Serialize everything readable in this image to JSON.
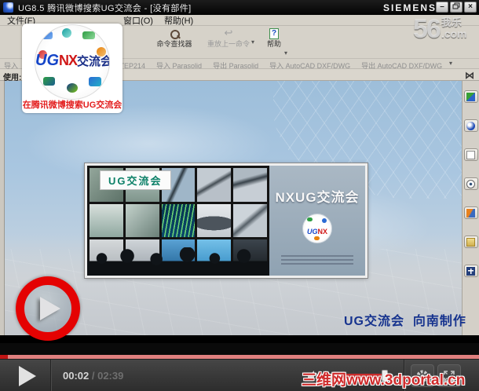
{
  "window": {
    "title": "UG8.5 腾讯微博搜索UG交流会 - [没有部件]",
    "brand": "SIEMENS",
    "controls": {
      "minimize": "–",
      "close": "×"
    },
    "menus": {
      "file": "文件(F)",
      "window": "窗口(O)",
      "help": "帮助(H)"
    },
    "toolbar": {
      "command_finder": "命令查找器",
      "replay_last": "重放上一命令",
      "help": "帮助",
      "help_glyph": "?",
      "chevron": "▾"
    },
    "import_bar": {
      "fragment": "导入",
      "items": [
        "导入 STEP214",
        "导入 Parasolid",
        "导出 Parasolid",
        "导入 AutoCAD DXF/DWG",
        "导出 AutoCAD DXF/DWG"
      ],
      "chevron": "▾"
    },
    "status": {
      "label": "使用:",
      "fit_glyph": "⋈"
    }
  },
  "video": {
    "logo_card": {
      "ug": "UG",
      "nx": "NX",
      "suffix": "交流会",
      "caption": "在腾讯微博搜索UG交流会"
    },
    "banner": {
      "label": "UG交流会",
      "title": "NXUG交流会",
      "mini_ug": "UG",
      "mini_nx": "NX"
    },
    "credit": "UG交流会  向南制作"
  },
  "player": {
    "time_current": "00:02",
    "time_sep": " / ",
    "time_total": "02:39",
    "colors": {
      "play_ring_red": "#e40202",
      "progress_played": "#c01414",
      "progress_track": "#e0807f",
      "volume_red": "#c62828",
      "controlbar_bg": "#3a3a3a",
      "credit_blue": "#16338e"
    }
  },
  "watermarks": {
    "site_number": "56",
    "site_cn": "我乐",
    "site_tld": ".com",
    "portal": "三维网www.3dportal.cn"
  }
}
